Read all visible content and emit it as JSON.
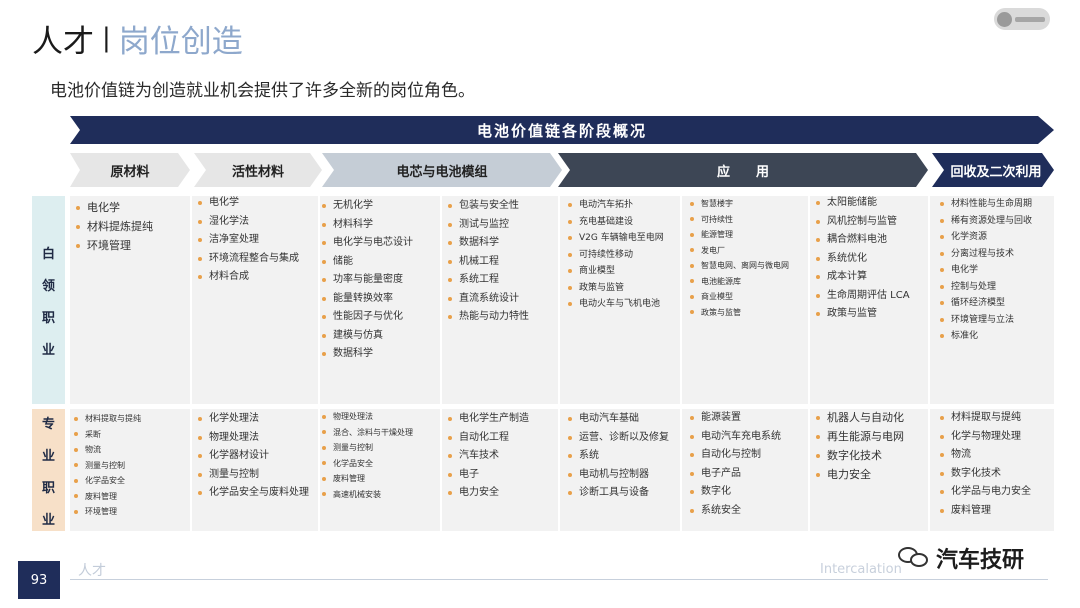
{
  "header": {
    "title_main": "人才",
    "title_sep": "|",
    "title_sub": "岗位创造",
    "subtitle": "电池价值链为创造就业机会提供了许多全新的岗位角色。"
  },
  "banner": {
    "title": "电池价值链各阶段概况"
  },
  "stages": [
    "原材料",
    "活性材料",
    "电芯与电池模组",
    "应　　用",
    "回收及二次利用"
  ],
  "row_labels": {
    "white_collar": [
      "白",
      "领",
      "职",
      "业"
    ],
    "professional": [
      "专",
      "业",
      "职",
      "业"
    ]
  },
  "white_collar_columns": [
    [
      "电化学",
      "材料提炼提纯",
      "环境管理"
    ],
    [
      "电化学",
      "湿化学法",
      "洁净室处理",
      "环境流程整合与集成",
      "材料合成"
    ],
    [
      "无机化学",
      "材料科学",
      "电化学与电芯设计",
      "储能",
      "功率与能量密度",
      "能量转换效率",
      "性能因子与优化",
      "建模与仿真",
      "数据科学"
    ],
    [
      "包装与安全性",
      "测试与监控",
      "数据科学",
      "机械工程",
      "系统工程",
      "直流系统设计",
      "热能与动力特性"
    ],
    [
      "电动汽车拓扑",
      "充电基础建设",
      "V2G 车辆输电至电网",
      "可持续性移动",
      "商业模型",
      "政策与监管",
      "电动火车与飞机电池"
    ],
    [
      "智慧楼宇",
      "可持续性",
      "能源管理",
      "发电厂",
      "智慧电网、离网与微电网",
      "电池能源库",
      "商业模型",
      "政策与监管"
    ],
    [
      "太阳能储能",
      "风机控制与监管",
      "耦合燃料电池",
      "系统优化",
      "成本计算",
      "生命周期评估 LCA",
      "政策与监管"
    ],
    [
      "材料性能与生命周期",
      "稀有资源处理与回收",
      "化学资源",
      "分离过程与技术",
      "电化学",
      "控制与处理",
      "循环经济模型",
      "环境管理与立法",
      "标准化"
    ]
  ],
  "professional_columns": [
    [
      "材料提取与提纯",
      "采断",
      "物流",
      "测量与控制",
      "化学品安全",
      "废料管理",
      "环境管理"
    ],
    [
      "化学处理法",
      "物理处理法",
      "化学器材设计",
      "测量与控制",
      "化学品安全与废料处理"
    ],
    [
      "物理处理法",
      "混合、涂料与干燥处理",
      "测量与控制",
      "化学品安全",
      "废料管理",
      "高速机械安装"
    ],
    [
      "电化学生产制造",
      "自动化工程",
      "汽车技术",
      "电子",
      "电力安全"
    ],
    [
      "电动汽车基础",
      "运营、诊断以及修复",
      "系统",
      "电动机与控制器",
      "诊断工具与设备"
    ],
    [
      "能源装置",
      "电动汽车充电系统",
      "自动化与控制",
      "电子产品",
      "数字化",
      "系统安全"
    ],
    [
      "机器人与自动化",
      "再生能源与电网",
      "数字化技术",
      "电力安全"
    ],
    [
      "材料提取与提纯",
      "化学与物理处理",
      "物流",
      "数字化技术",
      "化学品与电力安全",
      "废料管理"
    ]
  ],
  "footer": {
    "page_number": "93",
    "left_text": "人才",
    "right_text": "Intercalation",
    "watermark": "汽车技研"
  },
  "colors": {
    "banner": "#1f2d5a",
    "stage_light": "#e6e6e6",
    "stage_mid": "#c5cdd6",
    "stage_dark": "#3d4655",
    "white_label_bg": "#ddeef0",
    "pro_label_bg": "#f7e0c8",
    "bullet": "#e8a04a",
    "title_accent": "#8ea8cc"
  },
  "icons": [
    "logo-icon",
    "wechat-icon"
  ]
}
